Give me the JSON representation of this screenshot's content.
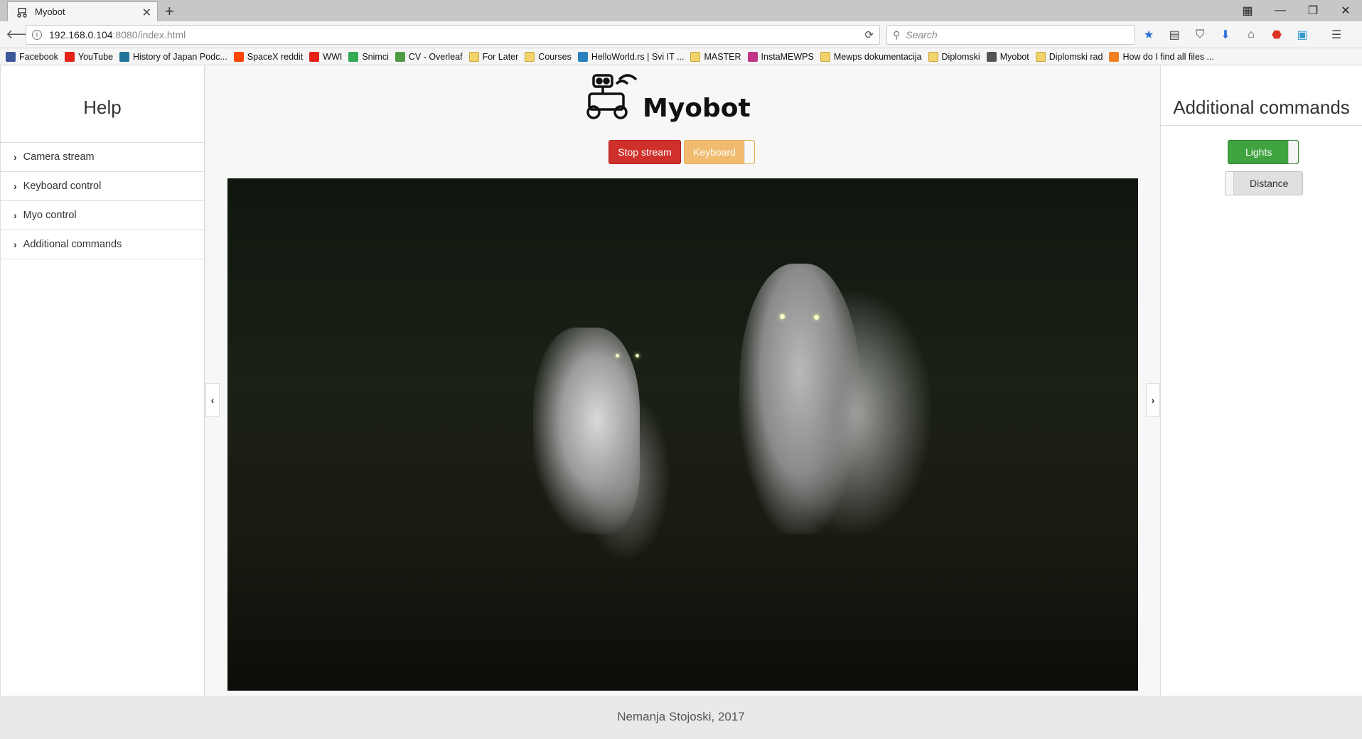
{
  "browser": {
    "tab_title": "Myobot",
    "tab_close": "✕",
    "new_tab": "+",
    "url_host": "192.168.0.104",
    "url_path": ":8080/index.html",
    "search_placeholder": "Search",
    "window_buttons": [
      "▦",
      "—",
      "❐",
      "✕"
    ],
    "bookmarks": [
      {
        "label": "Facebook",
        "icon": "facebook-icon",
        "color": "#3b5998"
      },
      {
        "label": "YouTube",
        "icon": "youtube-icon",
        "color": "#e62117"
      },
      {
        "label": "History of Japan Podc...",
        "icon": "wordpress-icon",
        "color": "#21759b"
      },
      {
        "label": "SpaceX reddit",
        "icon": "reddit-icon",
        "color": "#ff4500"
      },
      {
        "label": "WWI",
        "icon": "youtube-icon",
        "color": "#e62117"
      },
      {
        "label": "Snimci",
        "icon": "drive-icon",
        "color": "#34a853"
      },
      {
        "label": "CV - Overleaf",
        "icon": "overleaf-icon",
        "color": "#4f9c45"
      },
      {
        "label": "For Later",
        "icon": "folder-icon",
        "color": "#f2d36b"
      },
      {
        "label": "Courses",
        "icon": "folder-icon",
        "color": "#f2d36b"
      },
      {
        "label": "HelloWorld.rs | Svi IT ...",
        "icon": "helloworld-icon",
        "color": "#2a7fbf"
      },
      {
        "label": "MASTER",
        "icon": "folder-icon",
        "color": "#f2d36b"
      },
      {
        "label": "InstaMEWPS",
        "icon": "instagram-icon",
        "color": "#c13584"
      },
      {
        "label": "Mewps dokumentacija",
        "icon": "folder-icon",
        "color": "#f2d36b"
      },
      {
        "label": "Diplomski",
        "icon": "folder-icon",
        "color": "#f2d36b"
      },
      {
        "label": "Myobot",
        "icon": "robot-icon",
        "color": "#555555"
      },
      {
        "label": "Diplomski rad",
        "icon": "folder-icon",
        "color": "#f2d36b"
      },
      {
        "label": "How do I find all files ...",
        "icon": "stackoverflow-icon",
        "color": "#f48024"
      }
    ]
  },
  "left_panel": {
    "title": "Help",
    "items": [
      {
        "label": "Camera stream"
      },
      {
        "label": "Keyboard control"
      },
      {
        "label": "Myo control"
      },
      {
        "label": "Additional commands"
      }
    ]
  },
  "center": {
    "logo_text": "Myobot",
    "stop_stream_label": "Stop stream",
    "keyboard_label": "Keyboard",
    "keyboard_on": false,
    "left_toggle": "‹",
    "right_toggle": "›"
  },
  "right_panel": {
    "title": "Additional commands",
    "lights_label": "Lights",
    "lights_on": true,
    "distance_label": "Distance",
    "distance_on": false
  },
  "footer": {
    "text": "Nemanja Stojoski, 2017"
  }
}
